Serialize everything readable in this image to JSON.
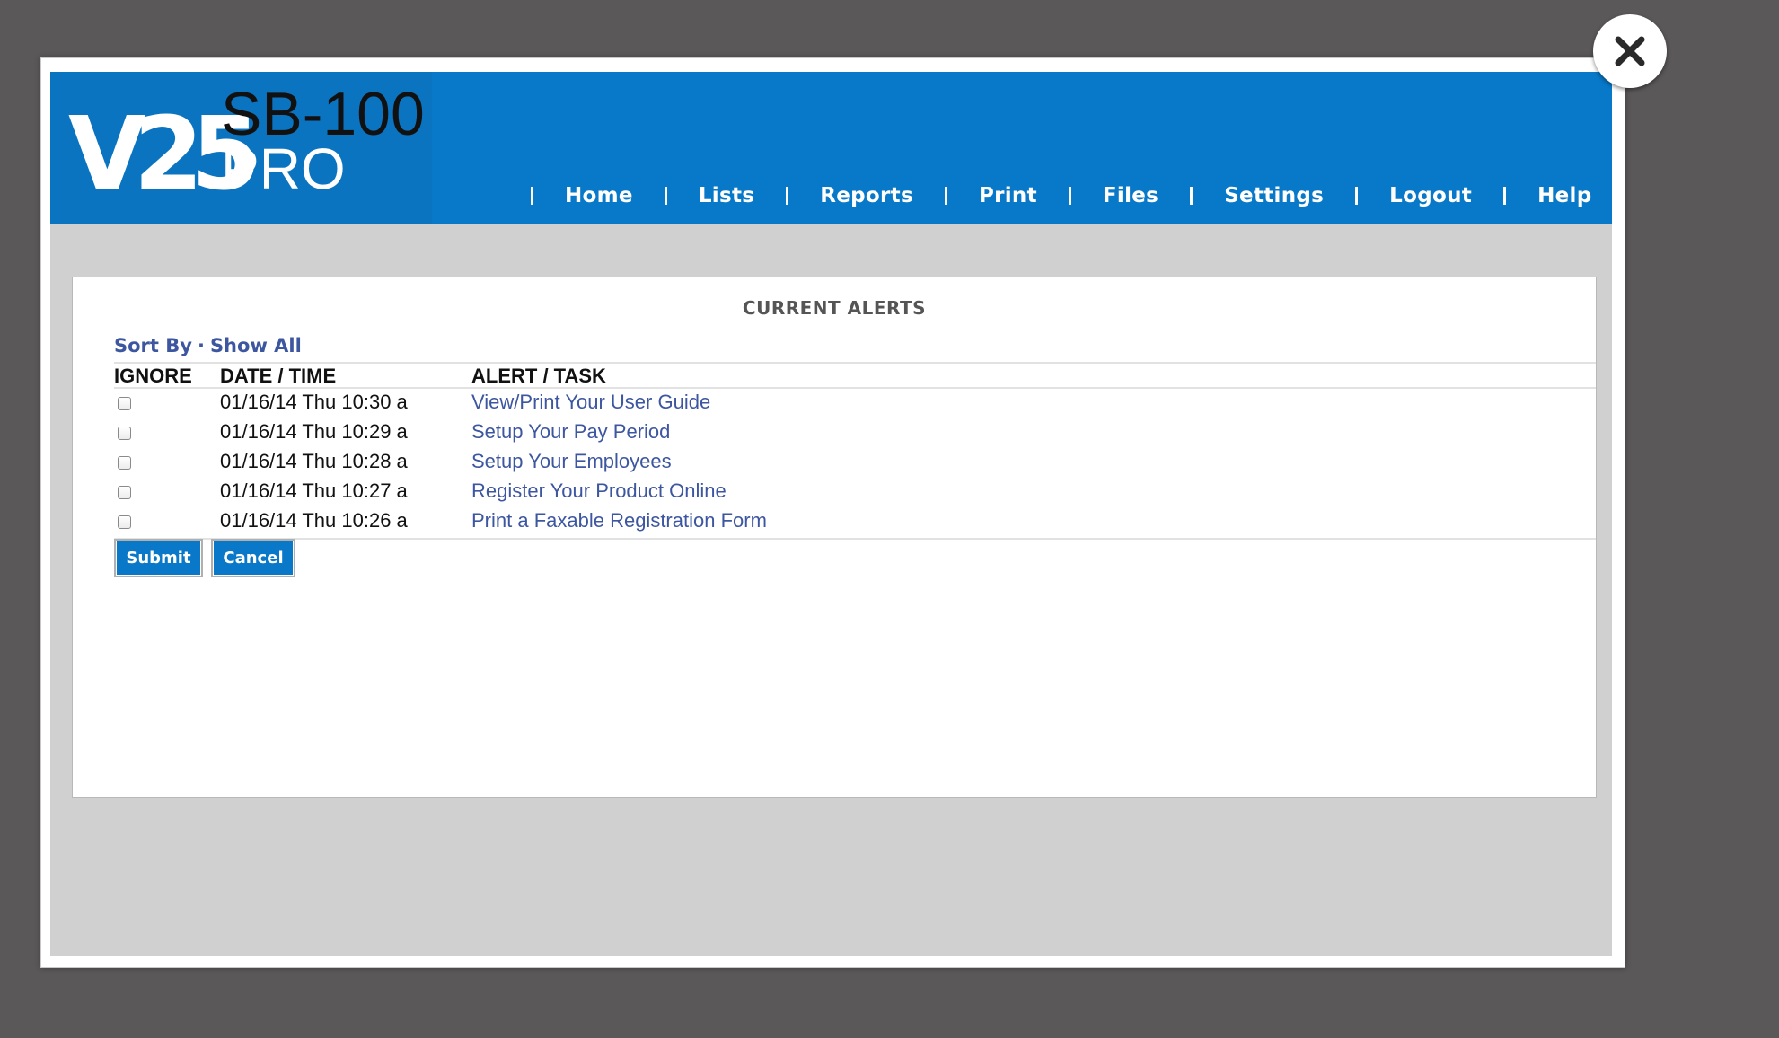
{
  "logo": {
    "mark": "V25",
    "line1": "SB-100",
    "line2": "PRO"
  },
  "nav": {
    "items": [
      "Home",
      "Lists",
      "Reports",
      "Print",
      "Files",
      "Settings",
      "Logout",
      "Help"
    ]
  },
  "panel": {
    "title": "CURRENT ALERTS",
    "sort_by": "Sort By",
    "separator": "·",
    "show_all": "Show All"
  },
  "table": {
    "headers": {
      "ignore": "IGNORE",
      "datetime": "DATE / TIME",
      "task": "ALERT / TASK"
    },
    "rows": [
      {
        "datetime": "01/16/14 Thu 10:30 a",
        "task": "View/Print Your User Guide",
        "checked": false
      },
      {
        "datetime": "01/16/14 Thu 10:29 a",
        "task": "Setup Your Pay Period",
        "checked": false
      },
      {
        "datetime": "01/16/14 Thu 10:28 a",
        "task": "Setup Your Employees",
        "checked": false
      },
      {
        "datetime": "01/16/14 Thu 10:27 a",
        "task": "Register Your Product Online",
        "checked": false
      },
      {
        "datetime": "01/16/14 Thu 10:26 a",
        "task": "Print a Faxable Registration Form",
        "checked": false
      }
    ]
  },
  "buttons": {
    "submit": "Submit",
    "cancel": "Cancel"
  },
  "colors": {
    "header_blue": "#0878c8",
    "link_blue": "#3d56a0",
    "overlay": "#5b5859",
    "panel_gray": "#d0d0d0"
  },
  "icons": {
    "close": "close-icon"
  }
}
